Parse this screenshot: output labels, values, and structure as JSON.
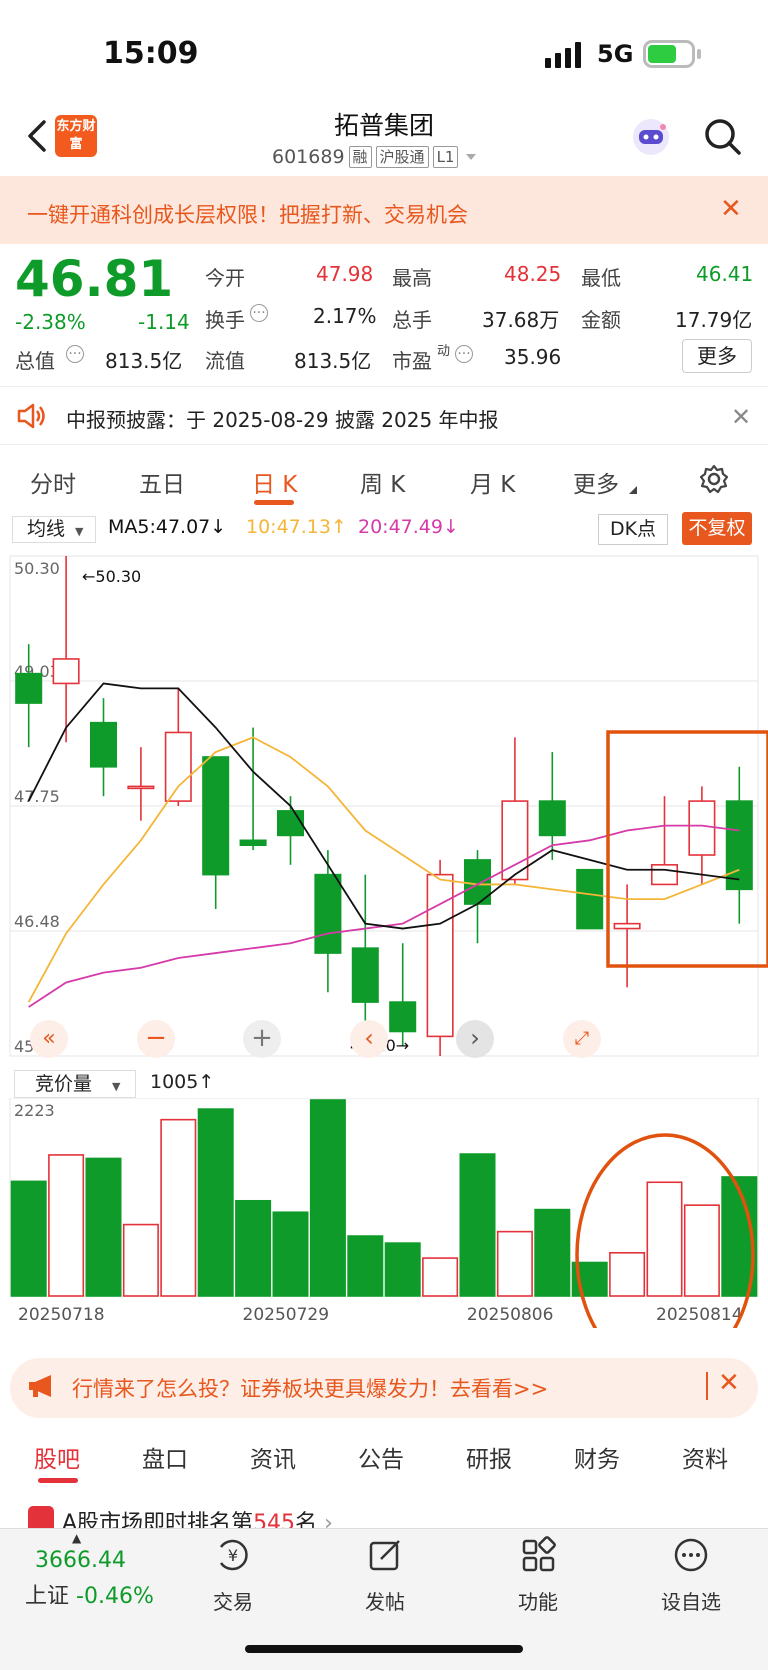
{
  "status_bar": {
    "time": "15:09",
    "network": "5G"
  },
  "header": {
    "logo_text": "东方财富",
    "title": "拓普集团",
    "code": "601689",
    "tags": [
      "融",
      "沪股通",
      "L1"
    ]
  },
  "promo": {
    "text": "一键开通科创成长层权限！把握打新、交易机会",
    "close": "✕"
  },
  "quote": {
    "price": "46.81",
    "change_pct": "-2.38%",
    "change": "-1.14",
    "open_label": "今开",
    "open": "47.98",
    "high_label": "最高",
    "high": "48.25",
    "low_label": "最低",
    "low": "46.41",
    "turnover_label": "换手",
    "turnover": "2.17%",
    "volume_label": "总手",
    "volume": "37.68万",
    "amount_label": "金额",
    "amount": "17.79亿",
    "mcap_label": "总值",
    "mcap": "813.5亿",
    "float_label": "流值",
    "float": "813.5亿",
    "pe_label": "市盈",
    "pe_sup": "动",
    "pe": "35.96",
    "more": "更多"
  },
  "notice": {
    "text": "中报预披露：于 2025-08-29 披露 2025 年中报",
    "close": "✕"
  },
  "ktabs": [
    "分时",
    "五日",
    "日 K",
    "周 K",
    "月 K",
    "更多"
  ],
  "chart_toolbar": {
    "ma_select": "均线",
    "ma5": "MA5:47.07↓",
    "ma10": "10:47.13↑",
    "ma20": "20:47.49↓",
    "dk": "DK点",
    "fq": "不复权"
  },
  "colors": {
    "up": "#e3323a",
    "down": "#0f9b2a",
    "accent": "#e8571d",
    "ma5": "#111111",
    "ma10": "#f5b638",
    "ma20": "#d63aa8"
  },
  "chart_data": {
    "type": "candlestick",
    "ylim": [
      45.2,
      50.3
    ],
    "y_ticks": [
      "50.30",
      "49.03",
      "47.75",
      "46.48",
      "45.20"
    ],
    "max_label": "←50.30",
    "min_label": "45.20→",
    "candles": [
      {
        "o": 49.1,
        "c": 48.8,
        "h": 49.4,
        "l": 48.35
      },
      {
        "o": 49.0,
        "c": 49.25,
        "h": 50.3,
        "l": 48.4
      },
      {
        "o": 48.6,
        "c": 48.15,
        "h": 48.85,
        "l": 47.85
      },
      {
        "o": 47.95,
        "c": 47.95,
        "h": 48.35,
        "l": 47.6
      },
      {
        "o": 47.8,
        "c": 48.5,
        "h": 48.95,
        "l": 47.75
      },
      {
        "o": 48.25,
        "c": 47.05,
        "h": 48.25,
        "l": 46.7
      },
      {
        "o": 47.4,
        "c": 47.35,
        "h": 48.55,
        "l": 47.3
      },
      {
        "o": 47.7,
        "c": 47.45,
        "h": 47.85,
        "l": 47.15
      },
      {
        "o": 47.05,
        "c": 46.25,
        "h": 47.3,
        "l": 45.85
      },
      {
        "o": 46.3,
        "c": 45.75,
        "h": 47.05,
        "l": 45.5
      },
      {
        "o": 45.75,
        "c": 45.45,
        "h": 46.35,
        "l": 45.3
      },
      {
        "o": 45.4,
        "c": 47.05,
        "h": 47.2,
        "l": 45.2
      },
      {
        "o": 47.2,
        "c": 46.75,
        "h": 47.3,
        "l": 46.35
      },
      {
        "o": 47.0,
        "c": 47.8,
        "h": 48.45,
        "l": 46.95
      },
      {
        "o": 47.8,
        "c": 47.45,
        "h": 48.3,
        "l": 47.2
      },
      {
        "o": 47.1,
        "c": 46.5,
        "h": 47.1,
        "l": 46.5
      },
      {
        "o": 46.5,
        "c": 46.55,
        "h": 46.95,
        "l": 45.9
      },
      {
        "o": 46.95,
        "c": 47.15,
        "h": 47.85,
        "l": 46.95
      },
      {
        "o": 47.25,
        "c": 47.8,
        "h": 47.95,
        "l": 46.95
      },
      {
        "o": 47.8,
        "c": 46.9,
        "h": 48.15,
        "l": 46.55
      }
    ],
    "ma5": [
      47.8,
      48.55,
      49.0,
      48.95,
      48.95,
      48.55,
      48.1,
      47.75,
      47.15,
      46.55,
      46.5,
      46.55,
      46.75,
      47.05,
      47.3,
      47.2,
      47.1,
      47.1,
      47.05,
      47.0
    ],
    "ma10": [
      45.75,
      46.45,
      46.95,
      47.4,
      47.95,
      48.3,
      48.45,
      48.25,
      47.95,
      47.5,
      47.25,
      47.0,
      46.95,
      46.95,
      46.9,
      46.85,
      46.8,
      46.8,
      46.95,
      47.1
    ],
    "ma20": [
      45.7,
      45.95,
      46.05,
      46.1,
      46.2,
      46.25,
      46.3,
      46.35,
      46.45,
      46.5,
      46.55,
      46.75,
      46.95,
      47.15,
      47.35,
      47.4,
      47.5,
      47.55,
      47.55,
      47.5
    ],
    "volume_select": "竞价量",
    "volume_value": "1005↑",
    "volume_max_label": "2223",
    "volumes": [
      1300,
      1600,
      1560,
      810,
      2000,
      2120,
      1080,
      950,
      2223,
      680,
      600,
      430,
      1610,
      730,
      980,
      380,
      490,
      1290,
      1030,
      1350
    ],
    "date_labels": [
      "20250718",
      "20250729",
      "20250806",
      "20250814"
    ]
  },
  "ad": {
    "text": "行情来了怎么投？证券板块更具爆发力！去看看>>",
    "close": "✕"
  },
  "bottom_tabs": [
    "股吧",
    "盘口",
    "资讯",
    "公告",
    "研报",
    "财务",
    "资料"
  ],
  "rank": {
    "prefix": "A股市场即时排名第",
    "number": "545",
    "suffix": "名"
  },
  "bottom_nav": {
    "index_value": "3666.44",
    "index_name": "上证",
    "index_change": "-0.46%",
    "items": [
      "交易",
      "发帖",
      "功能",
      "设自选"
    ]
  }
}
